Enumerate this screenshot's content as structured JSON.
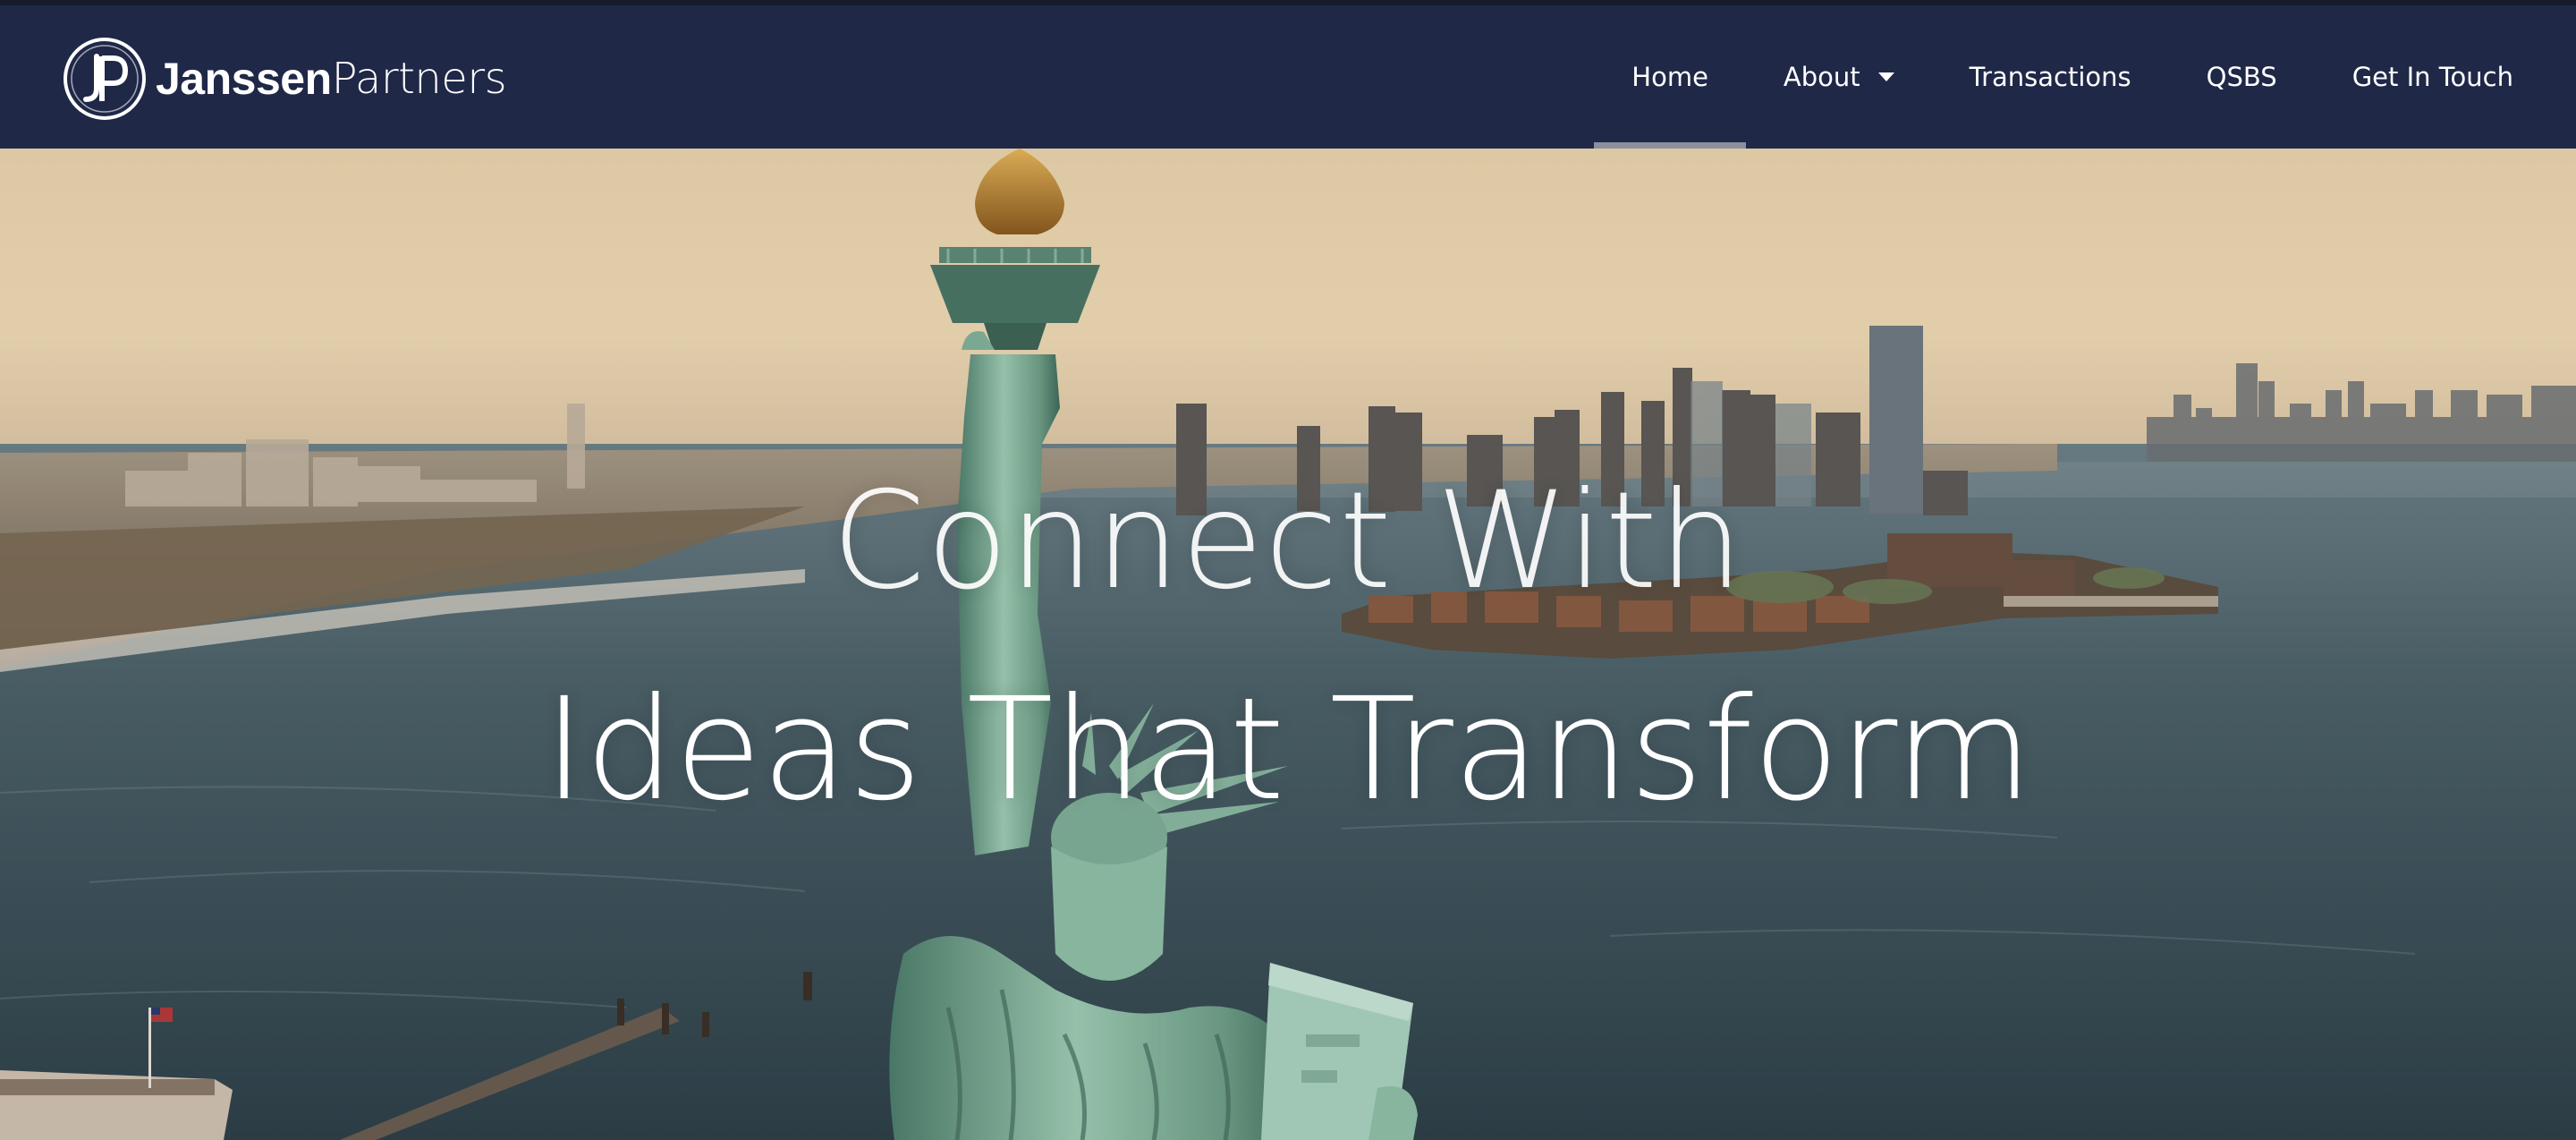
{
  "brand": {
    "name_bold": "Janssen",
    "name_light": "Partners",
    "monogram": "JP",
    "color_nav": "#1f2847",
    "color_topbar": "#171b2c",
    "color_active_underline": "#8b8f9e"
  },
  "nav": {
    "items": [
      {
        "label": "Home",
        "active": true
      },
      {
        "label": "About",
        "has_dropdown": true,
        "icon": "caret-down-icon"
      },
      {
        "label": "Transactions"
      },
      {
        "label": "QSBS"
      },
      {
        "label": "Get In Touch"
      }
    ]
  },
  "hero": {
    "line1": "Connect With",
    "line2": "Ideas That Transform",
    "background": "Aerial view of the Statue of Liberty with the Jersey City skyline and harbor at golden hour"
  }
}
